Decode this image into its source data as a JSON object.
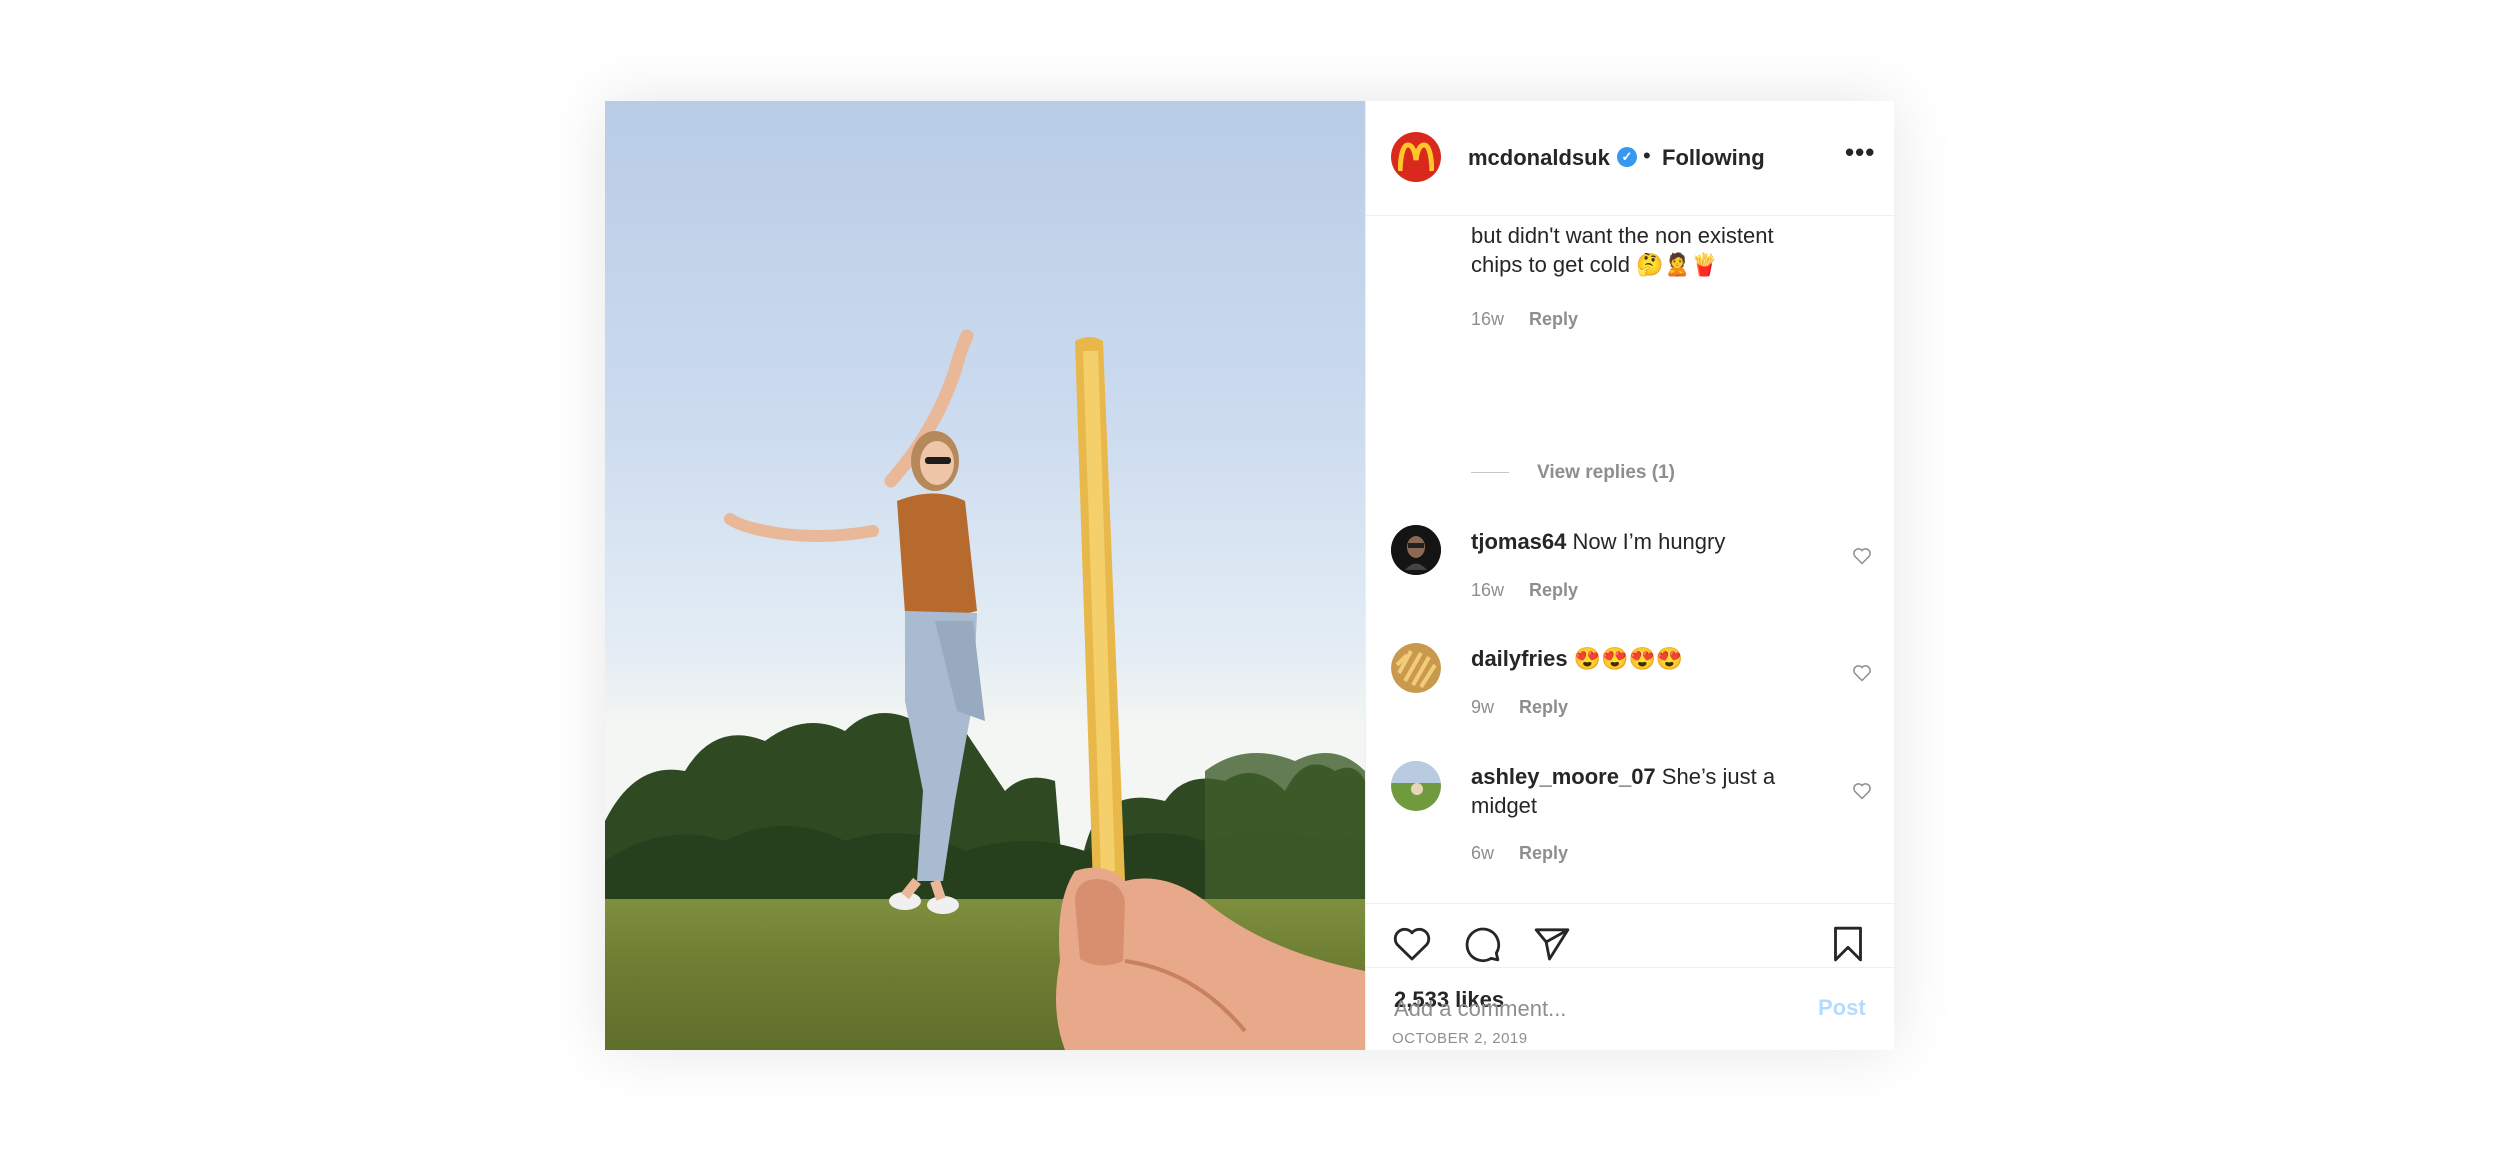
{
  "post": {
    "image_alt": "Woman pointing at a giant french fry held up in the foreground",
    "header": {
      "username": "mcdonaldsuk",
      "separator": "•",
      "follow_status": "Following",
      "more_icon": "more-horizontal-icon"
    },
    "comments": [
      {
        "type": "caption-continuation",
        "text_line1": "but didn't want the non existent",
        "text_line2": "chips to get cold 🤔🙎🍟",
        "age": "16w",
        "reply": "Reply",
        "view_replies": "View replies (1)"
      },
      {
        "username": "tjomas64",
        "text": "Now I’m hungry",
        "age": "16w",
        "reply": "Reply"
      },
      {
        "username": "dailyfries",
        "text": "😍😍😍😍",
        "age": "9w",
        "reply": "Reply"
      },
      {
        "username": "ashley_moore_07",
        "text_line1": "She’s just a",
        "text_line2": "midget",
        "age": "6w",
        "reply": "Reply"
      }
    ],
    "likes": "2,533 likes",
    "date": "OCTOBER 2, 2019",
    "add_comment": {
      "placeholder": "Add a comment...",
      "post_label": "Post"
    },
    "colors": {
      "brand_red": "#d9291c",
      "verified_blue": "#3897f0",
      "post_disabled": "#b3dbff"
    }
  }
}
